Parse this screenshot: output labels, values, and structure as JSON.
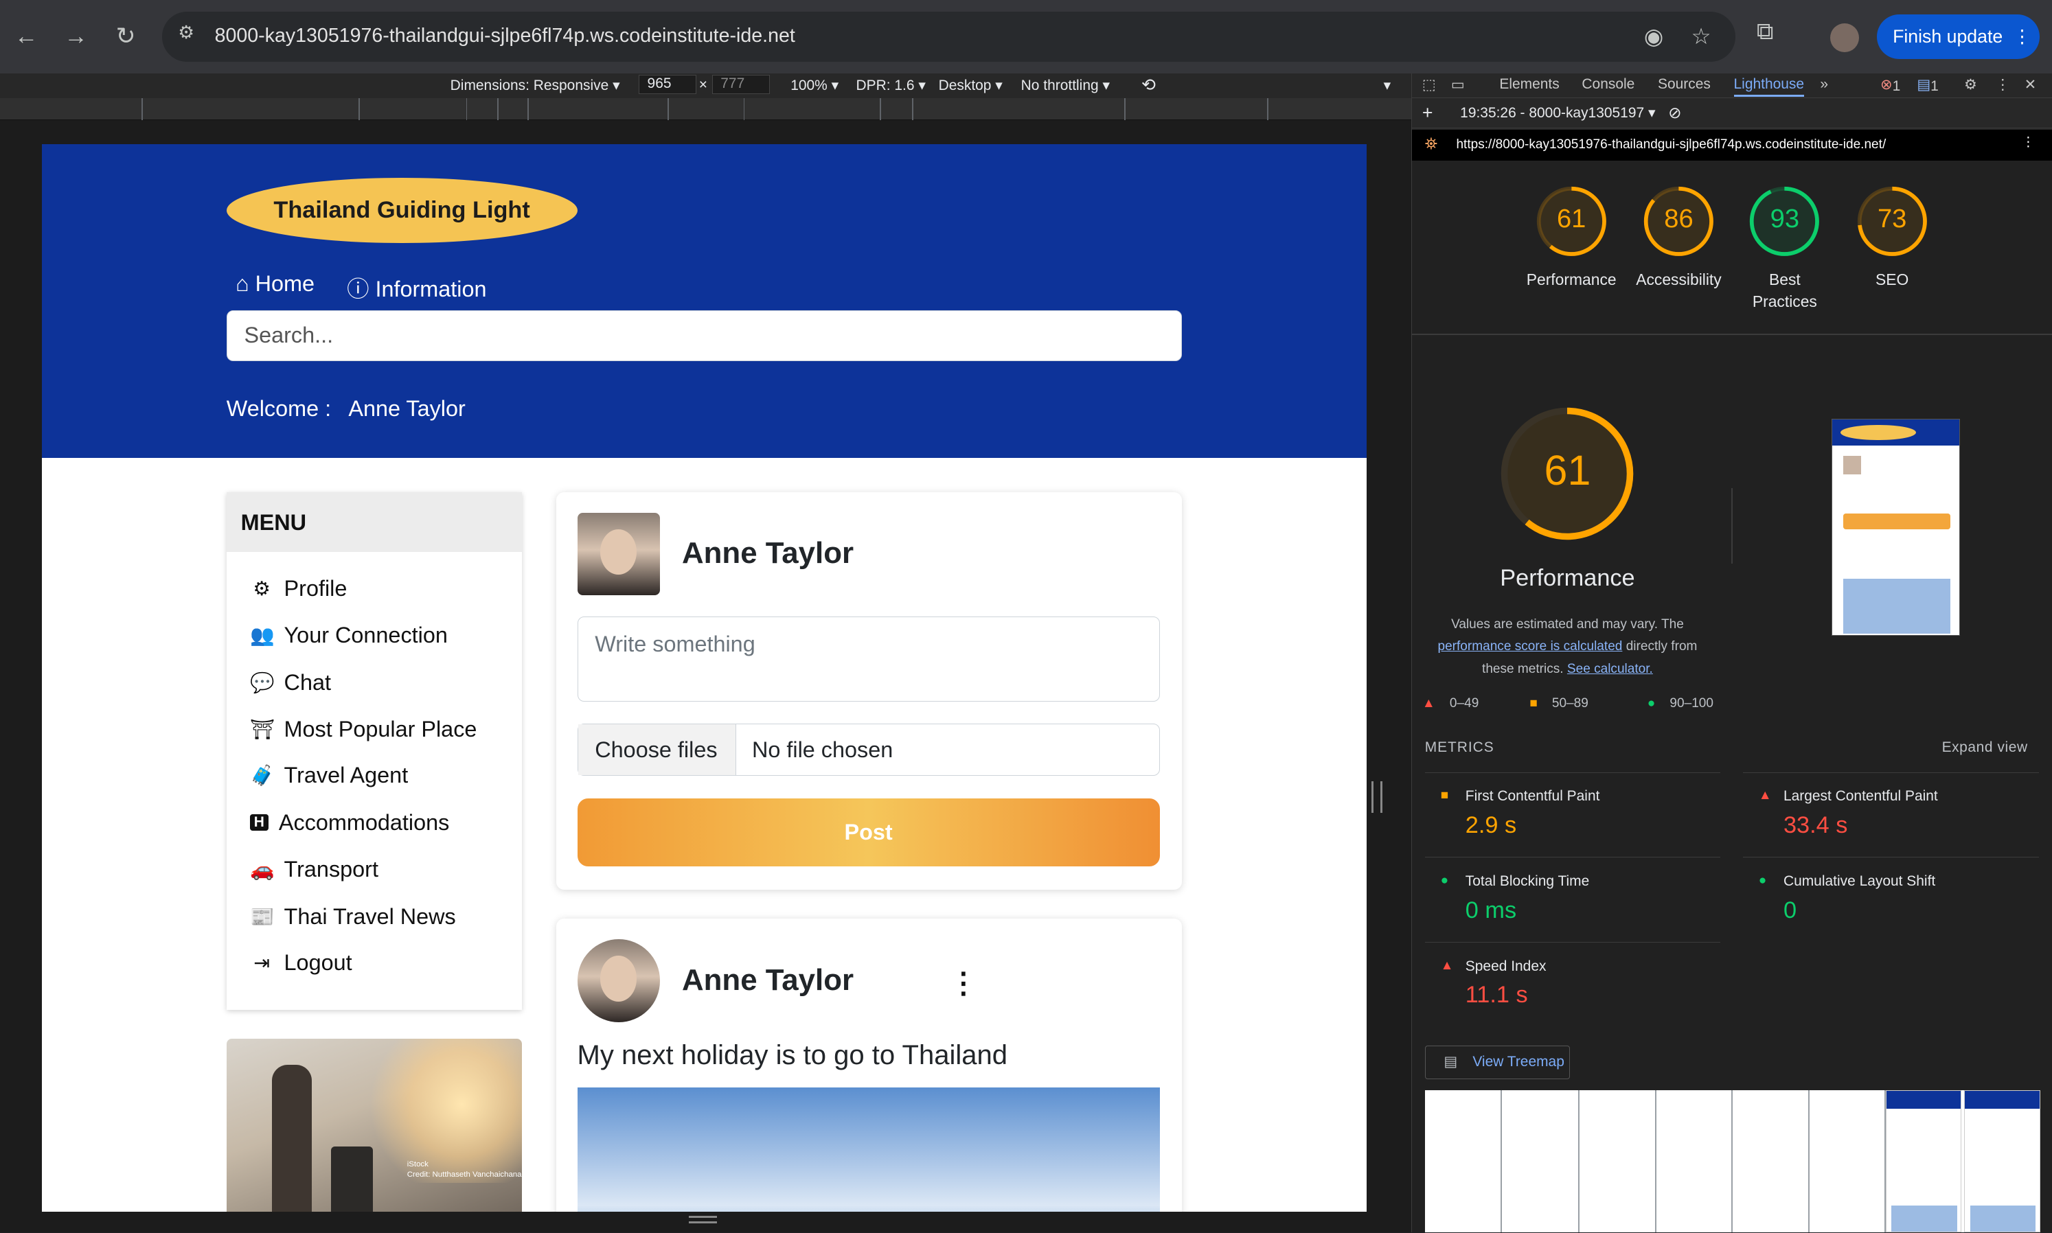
{
  "browser": {
    "url": "8000-kay13051976-thailandgui-sjlpe6fl74p.ws.codeinstitute-ide.net",
    "finish_update": "Finish update"
  },
  "device_toolbar": {
    "dimensions": "Dimensions: Responsive ▾",
    "width": "965",
    "times": "×",
    "height": "777",
    "zoom": "100% ▾",
    "dpr": "DPR: 1.6 ▾",
    "mode": "Desktop ▾",
    "throttle": "No throttling ▾"
  },
  "site": {
    "logo": "Thailand Guiding Light",
    "nav": [
      "Home",
      "Information"
    ],
    "search_placeholder": "Search...",
    "welcome_label": "Welcome :",
    "welcome_user": "Anne Taylor",
    "menu_title": "MENU",
    "menu_items": [
      {
        "label": "Profile",
        "icon": "gear-icon"
      },
      {
        "label": "Your Connection",
        "icon": "people-icon"
      },
      {
        "label": "Chat",
        "icon": "chat-icon"
      },
      {
        "label": "Most Popular Place",
        "icon": "temple-icon"
      },
      {
        "label": "Travel Agent",
        "icon": "luggage-cart-icon"
      },
      {
        "label": "Accommodations",
        "icon": "hotel-icon"
      },
      {
        "label": "Transport",
        "icon": "car-icon"
      },
      {
        "label": "Thai Travel News",
        "icon": "newspaper-icon"
      },
      {
        "label": "Logout",
        "icon": "logout-icon"
      }
    ],
    "photo_credit": "iStock\nCredit: Nutthaseth Vanchaichana",
    "composer": {
      "user": "Anne Taylor",
      "placeholder": "Write something",
      "choose_files": "Choose files",
      "no_file": "No file chosen",
      "post": "Post"
    },
    "post": {
      "user": "Anne Taylor",
      "text": "My next holiday is to go to Thailand"
    }
  },
  "devtools": {
    "tabs": [
      "Elements",
      "Console",
      "Sources",
      "Lighthouse"
    ],
    "active_tab": "Lighthouse",
    "error_count": "1",
    "message_count": "1",
    "report_label": "19:35:26 - 8000-kay1305197",
    "report_url": "https://8000-kay13051976-thailandgui-sjlpe6fl74p.ws.codeinstitute-ide.net/",
    "scores": [
      {
        "label": "Performance",
        "value": 61,
        "color": "#ffa400"
      },
      {
        "label": "Accessibility",
        "value": 86,
        "color": "#ffa400"
      },
      {
        "label": "Best Practices",
        "value": 93,
        "color": "#0cce6b"
      },
      {
        "label": "SEO",
        "value": 73,
        "color": "#ffa400"
      }
    ],
    "big_score": {
      "label": "Performance",
      "value": 61
    },
    "note_1": "Values are estimated and may vary. The",
    "note_link_1": "performance score is calculated",
    "note_2": "directly from",
    "note_3": "these metrics.",
    "note_link_2": "See calculator.",
    "legend": [
      "0–49",
      "50–89",
      "90–100"
    ],
    "metrics_title": "METRICS",
    "expand": "Expand view",
    "metrics": [
      {
        "label": "First Contentful Paint",
        "value": "2.9 s",
        "status": "average"
      },
      {
        "label": "Largest Contentful Paint",
        "value": "33.4 s",
        "status": "fail"
      },
      {
        "label": "Total Blocking Time",
        "value": "0 ms",
        "status": "pass"
      },
      {
        "label": "Cumulative Layout Shift",
        "value": "0",
        "status": "pass"
      },
      {
        "label": "Speed Index",
        "value": "11.1 s",
        "status": "fail"
      }
    ],
    "treemap": "View Treemap"
  },
  "colors": {
    "fail": "#ff4e42",
    "average": "#ffa400",
    "pass": "#0cce6b",
    "header_blue": "#0d3399"
  }
}
